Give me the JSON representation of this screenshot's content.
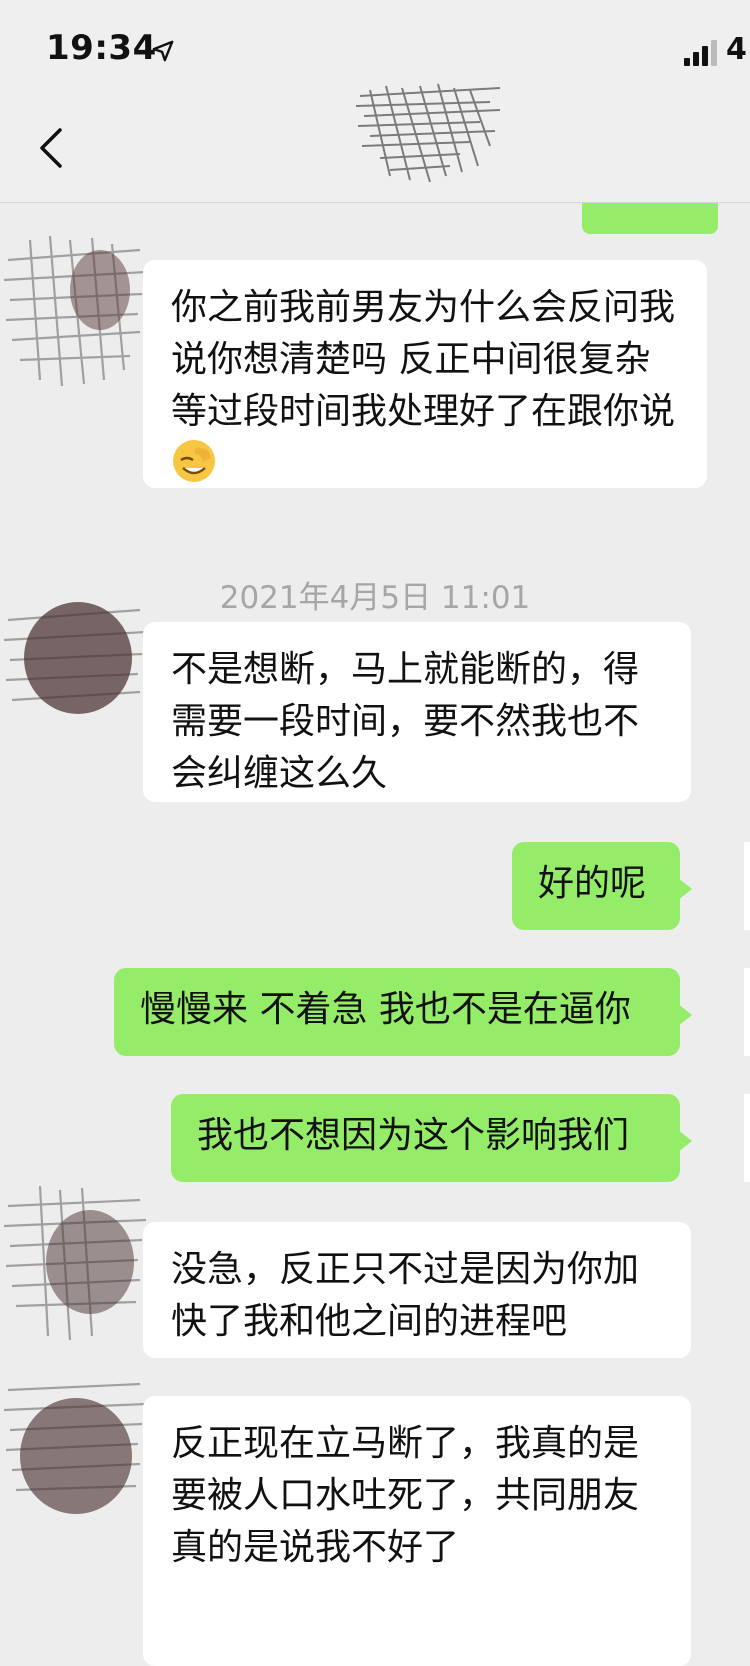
{
  "status_bar": {
    "time": "19:34",
    "carrier": "4"
  },
  "nav": {
    "back": "back"
  },
  "timestamp": "2021年4月5日 11:01",
  "messages": [
    {
      "side": "left",
      "text": "你之前我前男友为什么会反问我 说你想清楚吗 反正中间很复杂 等过段时间我处理好了在跟你说",
      "emoji": "face-with-hand-over-eyes"
    },
    {
      "side": "left",
      "text": "不是想断，马上就能断的，得需要一段时间，要不然我也不会纠缠这么久"
    },
    {
      "side": "right",
      "text": "好的呢"
    },
    {
      "side": "right",
      "text": "慢慢来 不着急 我也不是在逼你"
    },
    {
      "side": "right",
      "text": "我也不想因为这个影响我们"
    },
    {
      "side": "left",
      "text": "没急，反正只不过是因为你加快了我和他之间的进程吧"
    },
    {
      "side": "left",
      "text": "反正现在立马断了，我真的是要被人口水吐死了，共同朋友真的是说我不好了"
    }
  ],
  "colors": {
    "self_bubble": "#95ec69",
    "other_bubble": "#ffffff",
    "background": "#ededed"
  }
}
